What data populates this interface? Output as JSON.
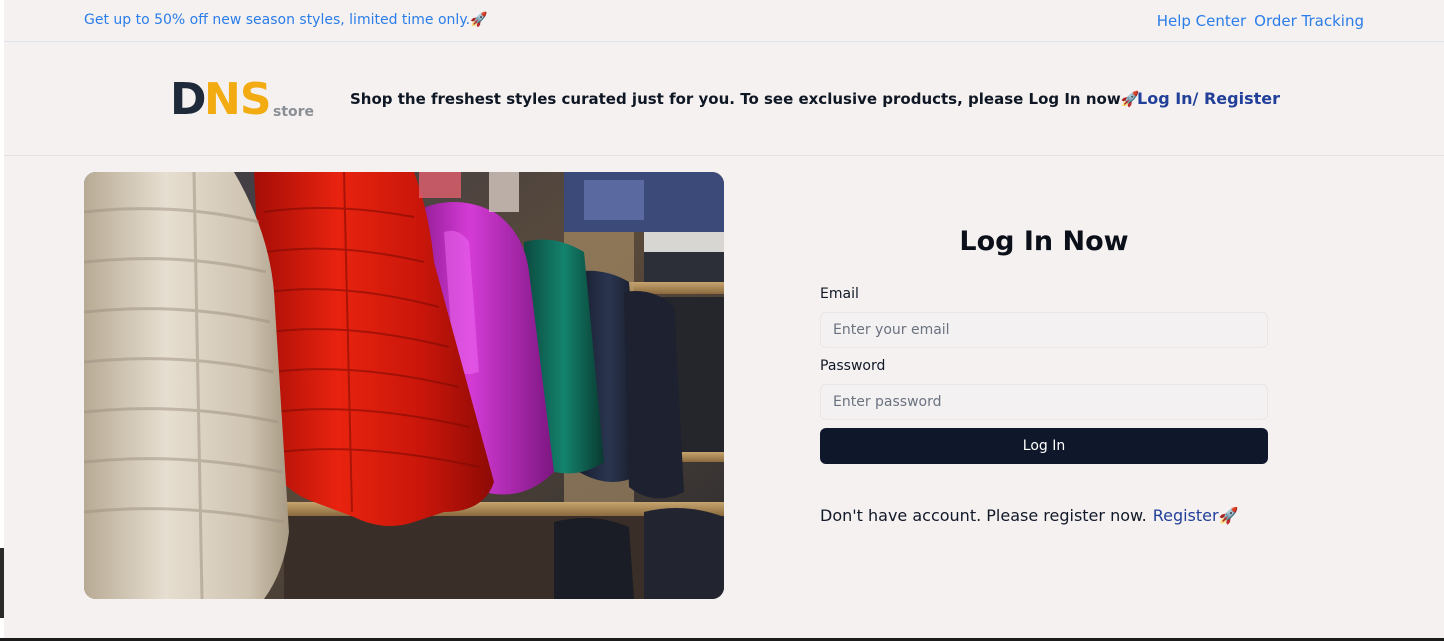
{
  "promo": {
    "text": "Get up to 50% off new season styles, limited time only.🚀"
  },
  "top_links": {
    "help_center": "Help Center",
    "order_tracking": "Order Tracking"
  },
  "header": {
    "logo_d": "D",
    "logo_ns": "NS",
    "logo_store": "store",
    "tagline": "Shop the freshest styles curated just for you. To see exclusive products, please Log In now🚀",
    "login_register": "Log In/ Register"
  },
  "login": {
    "title": "Log In Now",
    "email_label": "Email",
    "email_placeholder": "Enter your email",
    "password_label": "Password",
    "password_placeholder": "Enter password",
    "button_label": "Log In",
    "register_prompt": "Don't have account. Please register now.",
    "register_link": "Register🚀"
  },
  "colors": {
    "background": "#f4f1f0",
    "link_blue": "#2b7de9",
    "dark_blue": "#22409a",
    "button": "#0f172a",
    "logo_orange": "#f2ac12",
    "logo_dark": "#1e2a3a"
  },
  "hero_image": {
    "subject": "puffer jackets on a clothing rack in a store"
  }
}
